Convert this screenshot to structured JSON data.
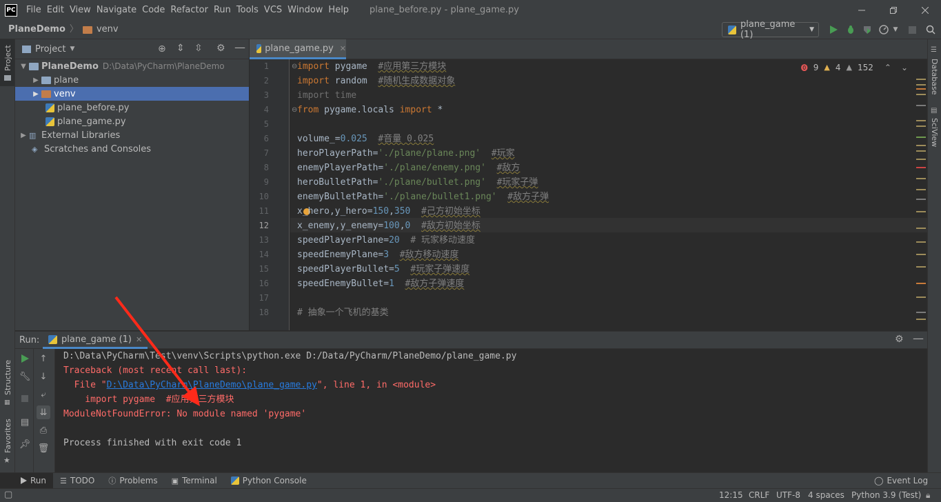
{
  "titlebar": {
    "logo": "PC",
    "menus": [
      "File",
      "Edit",
      "View",
      "Navigate",
      "Code",
      "Refactor",
      "Run",
      "Tools",
      "VCS",
      "Window",
      "Help"
    ],
    "title": "plane_before.py - plane_game.py"
  },
  "navbar": {
    "project": "PlaneDemo",
    "folder": "venv",
    "run_config": "plane_game (1)"
  },
  "left_strip": {
    "project": "Project",
    "structure": "Structure",
    "favorites": "Favorites"
  },
  "right_strip": {
    "database": "Database",
    "sciview": "SciView"
  },
  "project_panel": {
    "title": "Project",
    "tree": [
      {
        "label": "PlaneDemo",
        "path": "D:\\Data\\PyCharm\\PlaneDemo"
      },
      {
        "label": "plane"
      },
      {
        "label": "venv"
      },
      {
        "label": "plane_before.py"
      },
      {
        "label": "plane_game.py"
      },
      {
        "label": "External Libraries"
      },
      {
        "label": "Scratches and Consoles"
      }
    ]
  },
  "editor": {
    "tab": "plane_game.py",
    "inspections": {
      "errors": "9",
      "warnings": "4",
      "weak": "152"
    },
    "line_numbers": [
      "1",
      "2",
      "3",
      "4",
      "5",
      "6",
      "7",
      "8",
      "9",
      "10",
      "11",
      "12",
      "13",
      "14",
      "15",
      "16",
      "17",
      "18"
    ]
  },
  "run_panel": {
    "label": "Run:",
    "tab": "plane_game (1)",
    "lines": {
      "cmd": "D:\\Data\\PyCharm\\Test\\venv\\Scripts\\python.exe D:/Data/PyCharm/PlaneDemo/plane_game.py",
      "traceback": "Traceback (most recent call last):",
      "file_prefix": "  File \"",
      "file_link": "D:\\Data\\PyCharm\\PlaneDemo\\plane_game.py",
      "file_suffix": "\", line 1, in <module>",
      "import": "    import pygame  #应用第三方模块",
      "error": "ModuleNotFoundError: No module named 'pygame'",
      "exit": "Process finished with exit code 1"
    }
  },
  "tool_tabs": {
    "run": "Run",
    "todo": "TODO",
    "problems": "Problems",
    "terminal": "Terminal",
    "python_console": "Python Console",
    "event_log": "Event Log"
  },
  "statusbar": {
    "position": "12:15",
    "line_sep": "CRLF",
    "encoding": "UTF-8",
    "indent": "4 spaces",
    "interpreter": "Python 3.9 (Test)"
  },
  "colors": {
    "selection": "#4b6eaf",
    "error": "#ff6b68",
    "keyword": "#cc7832",
    "link": "#287bde",
    "run_green": "#499c54"
  }
}
